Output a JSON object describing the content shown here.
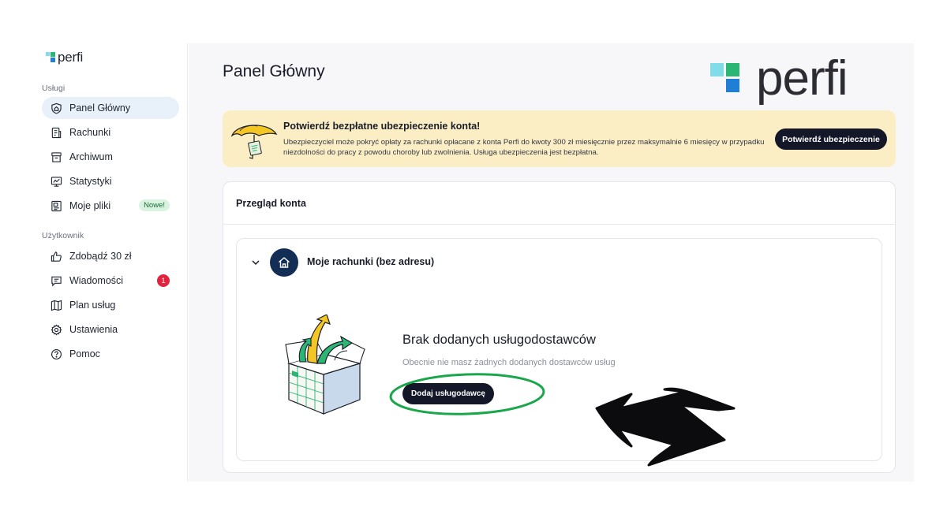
{
  "app": {
    "brand": "perfi"
  },
  "sidebar": {
    "section_services": "Usługi",
    "section_user": "Użytkownik",
    "services": [
      {
        "label": "Panel Główny",
        "icon": "shield-home-icon",
        "active": true
      },
      {
        "label": "Rachunki",
        "icon": "receipt-icon"
      },
      {
        "label": "Archiwum",
        "icon": "archive-box-icon"
      },
      {
        "label": "Statystyki",
        "icon": "stats-monitor-icon"
      },
      {
        "label": "Moje pliki",
        "icon": "files-icon",
        "badge": "Nowe!"
      }
    ],
    "user": [
      {
        "label": "Zdobądź 30 zł",
        "icon": "thumbs-up-icon"
      },
      {
        "label": "Wiadomości",
        "icon": "message-icon",
        "badge": "1"
      },
      {
        "label": "Plan usług",
        "icon": "map-plan-icon"
      },
      {
        "label": "Ustawienia",
        "icon": "gear-icon"
      },
      {
        "label": "Pomoc",
        "icon": "help-circle-icon"
      }
    ]
  },
  "main": {
    "title": "Panel Główny",
    "alert": {
      "title": "Potwierdź bezpłatne ubezpieczenie konta!",
      "body": "Ubezpieczyciel może pokryć opłaty za rachunki opłacane z konta Perfi do kwoty 300 zł miesięcznie przez maksymalnie 6 miesięcy w przypadku niezdolności do pracy z powodu choroby lub zwolnienia.  Usługa ubezpieczenia jest bezpłatna.",
      "button": "Potwierdź ubezpieczenie"
    },
    "overview": {
      "title": "Przegląd konta",
      "bills": {
        "title": "Moje rachunki (bez adresu)",
        "empty_title": "Brak dodanych usługodostawców",
        "empty_sub": "Obecnie nie masz żadnych dodanych dostawców usług",
        "button": "Dodaj usługodawcę"
      }
    }
  },
  "colors": {
    "accent_dark": "#131728",
    "alert_bg": "#fbeec4",
    "active_nav_bg": "#e8f0fa",
    "logo_cyan": "#7fdce8",
    "logo_teal": "#2bb673",
    "logo_blue": "#1f7fd6",
    "annotation_green": "#1aa64a"
  }
}
